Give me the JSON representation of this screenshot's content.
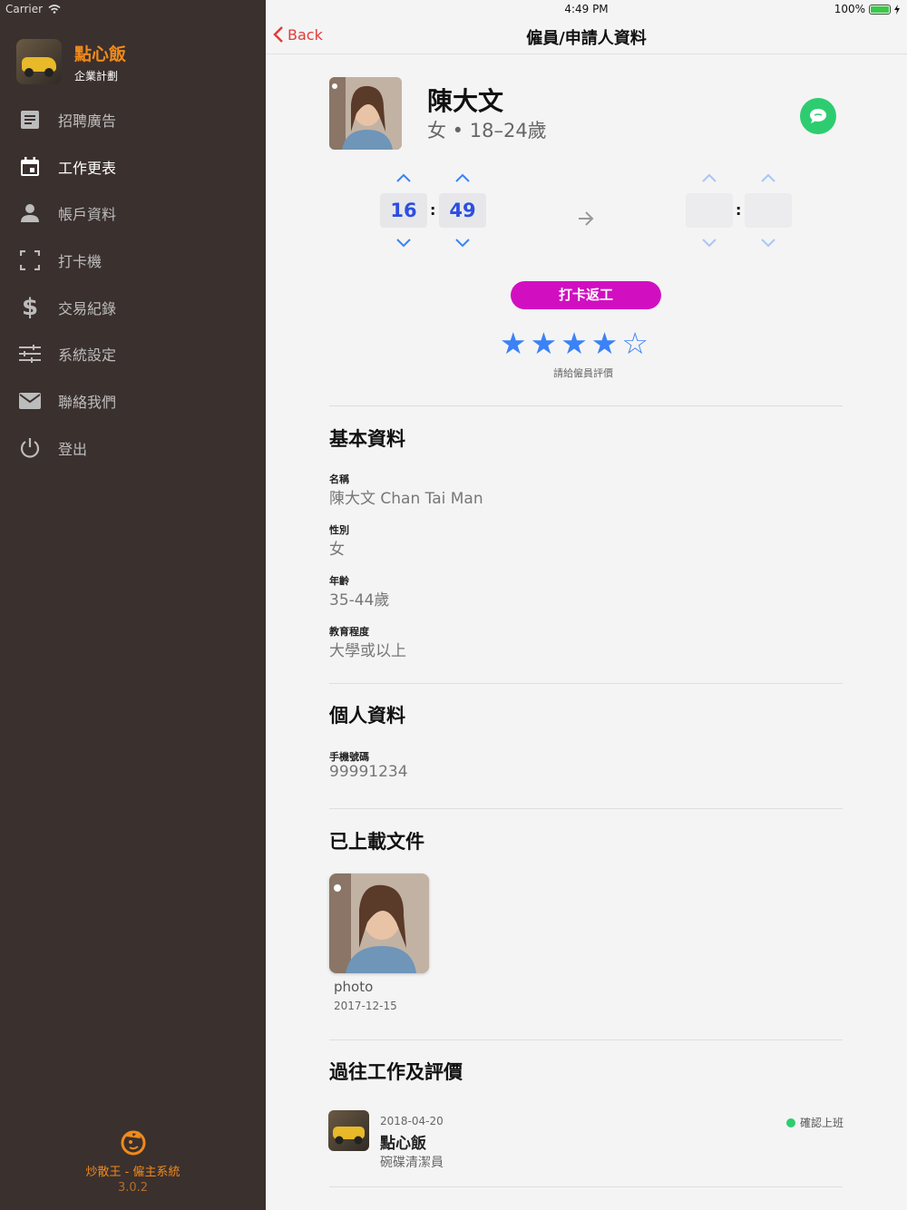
{
  "status_bar": {
    "carrier": "Carrier",
    "time": "4:49 PM",
    "battery": "100%"
  },
  "sidebar": {
    "brand_title": "點心飯",
    "brand_subtitle": "企業計劃",
    "items": [
      {
        "label": "招聘廣告",
        "icon": "document-icon",
        "active": false
      },
      {
        "label": "工作更表",
        "icon": "calendar-icon",
        "active": true
      },
      {
        "label": "帳戶資料",
        "icon": "person-icon",
        "active": false
      },
      {
        "label": "打卡機",
        "icon": "scan-icon",
        "active": false
      },
      {
        "label": "交易紀錄",
        "icon": "dollar-icon",
        "active": false
      },
      {
        "label": "系統設定",
        "icon": "sliders-icon",
        "active": false
      },
      {
        "label": "聯絡我們",
        "icon": "mail-icon",
        "active": false
      },
      {
        "label": "登出",
        "icon": "power-icon",
        "active": false
      }
    ],
    "footer_title": "炒散王 - 僱主系統",
    "footer_version": "3.0.2"
  },
  "navbar": {
    "back_label": "Back",
    "title": "僱員/申請人資料"
  },
  "profile": {
    "name": "陳大文",
    "meta": "女 • 18–24歲"
  },
  "time_picker": {
    "start_hour": "16",
    "start_minute": "49",
    "separator": ":",
    "end_hour": "",
    "end_minute": ""
  },
  "punch_button": "打卡返工",
  "rating": {
    "value": 4,
    "max": 5,
    "filled_star": "★",
    "empty_star": "☆",
    "label": "請給僱員評價"
  },
  "basic_info": {
    "title": "基本資料",
    "fields": [
      {
        "label": "名稱",
        "value": "陳大文 Chan Tai Man"
      },
      {
        "label": "性別",
        "value": "女"
      },
      {
        "label": "年齡",
        "value": "35-44歲"
      },
      {
        "label": "教育程度",
        "value": "大學或以上"
      }
    ]
  },
  "personal_info": {
    "title": "個人資料",
    "fields": [
      {
        "label": "手機號碼",
        "value": "99991234"
      }
    ]
  },
  "documents": {
    "title": "已上載文件",
    "items": [
      {
        "name": "photo",
        "date": "2017-12-15"
      }
    ]
  },
  "past_jobs": {
    "title": "過往工作及評價",
    "items": [
      {
        "date": "2018-04-20",
        "company": "點心飯",
        "role": "碗碟清潔員",
        "status": "確認上班"
      }
    ]
  },
  "colors": {
    "sidebar_bg": "#3a302e",
    "brand_orange": "#f08a1b",
    "back_red": "#e23b3b",
    "punch_magenta": "#d10fc1",
    "star_blue": "#3b82f6",
    "time_blue": "#2c4ee0",
    "chat_green": "#2ecc71"
  }
}
